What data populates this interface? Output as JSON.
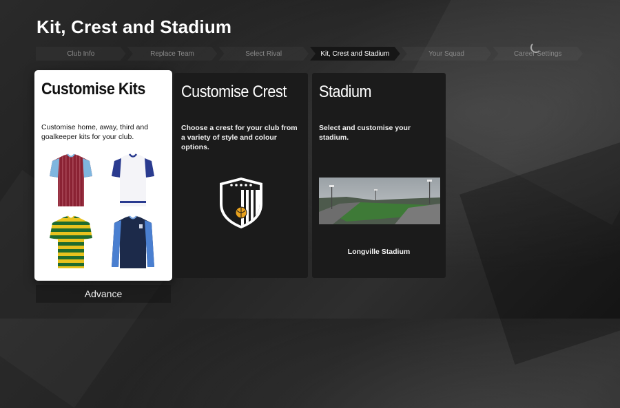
{
  "page": {
    "title": "Kit, Crest and Stadium"
  },
  "steps": [
    {
      "label": "Club Info",
      "active": false
    },
    {
      "label": "Replace Team",
      "active": false
    },
    {
      "label": "Select Rival",
      "active": false
    },
    {
      "label": "Kit, Crest and Stadium",
      "active": true
    },
    {
      "label": "Your Squad",
      "active": false
    },
    {
      "label": "Career Settings",
      "active": false
    }
  ],
  "cards": {
    "kits": {
      "title": "Customise Kits",
      "description": "Customise home, away, third and goalkeeper kits for your club.",
      "kit_icons": [
        "home-kit-icon",
        "away-kit-icon",
        "third-kit-icon",
        "goalkeeper-kit-icon"
      ]
    },
    "crest": {
      "title": "Customise Crest",
      "description": "Choose a crest for your club from a variety of style and colour options."
    },
    "stadium": {
      "title": "Stadium",
      "description": "Select and customise your stadium.",
      "name": "Longville Stadium"
    }
  },
  "footer": {
    "advance_label": "Advance"
  },
  "colors": {
    "accent_active_step": "#161616",
    "selected_card": "#ffffff",
    "card_background": "#1b1b1b"
  }
}
